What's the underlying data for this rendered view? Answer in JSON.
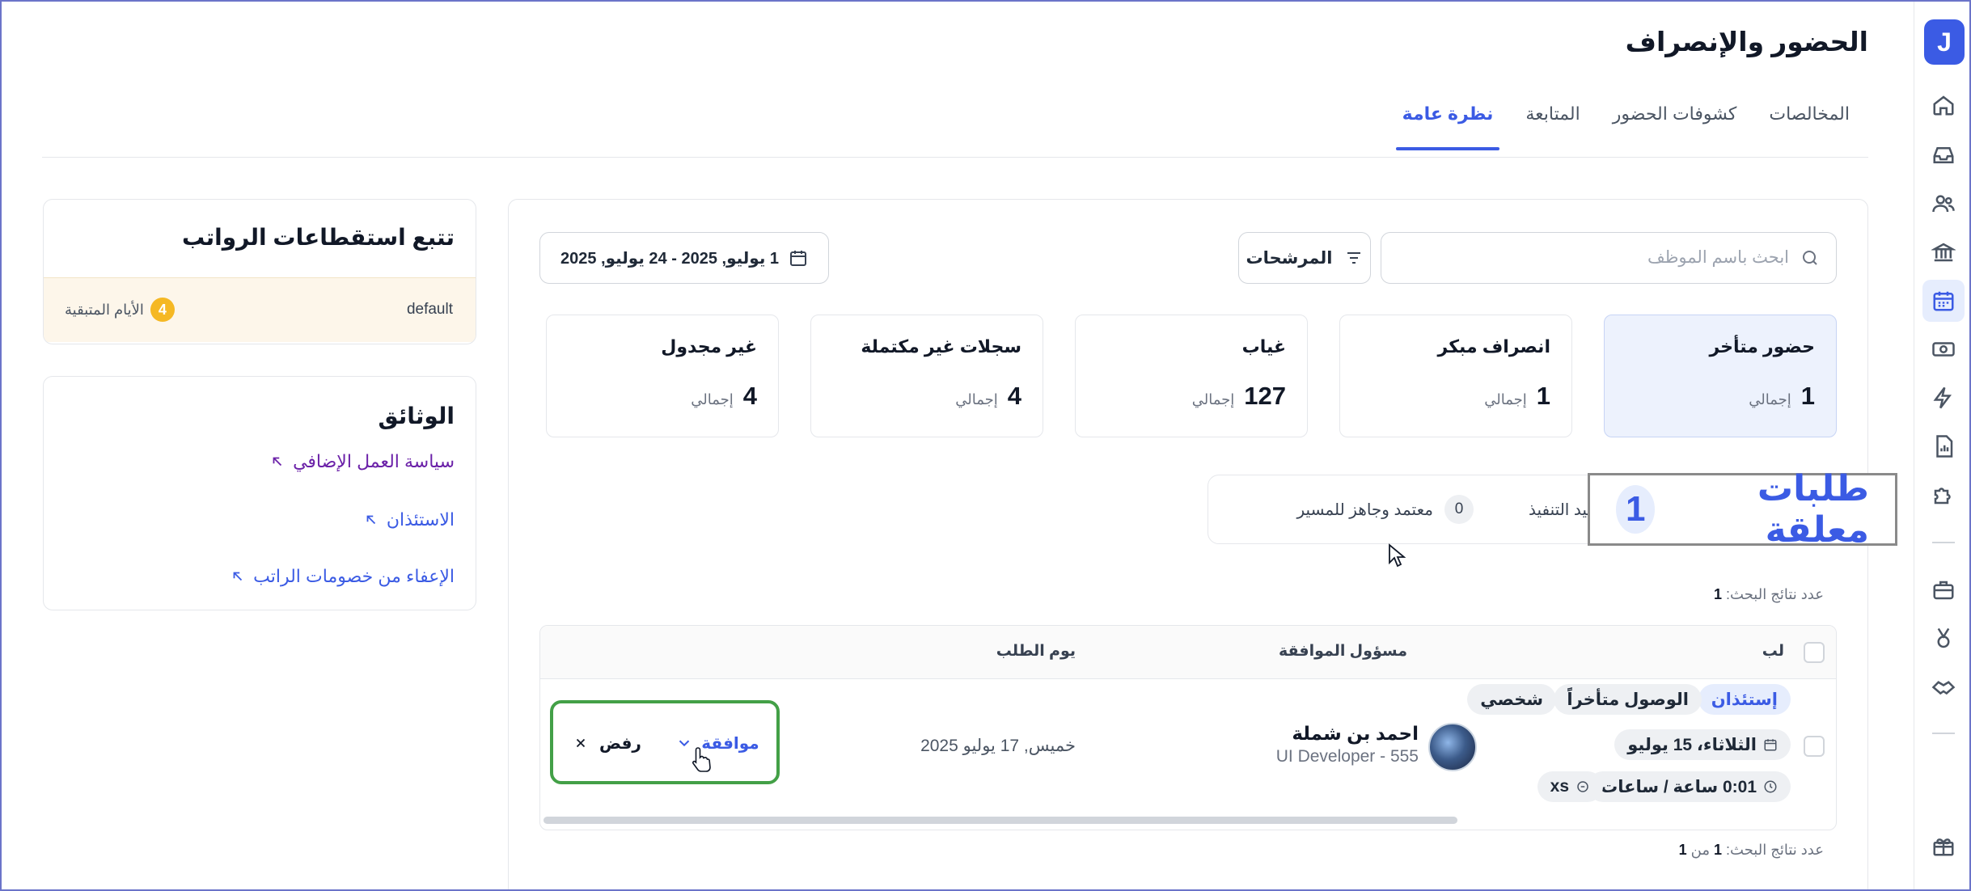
{
  "app": {
    "logo_letter": "J"
  },
  "header": {
    "title": "الحضور والإنصراف",
    "tabs": [
      {
        "label": "نظرة عامة",
        "active": true
      },
      {
        "label": "المتابعة",
        "active": false
      },
      {
        "label": "كشوفات الحضور",
        "active": false
      },
      {
        "label": "المخالصات",
        "active": false
      }
    ]
  },
  "sidebar": {
    "icons": [
      "home-icon",
      "inbox-icon",
      "users-icon",
      "bank-icon",
      "calendar-icon",
      "money-icon",
      "automation-icon",
      "report-icon",
      "puzzle-icon",
      "briefcase-icon",
      "medal-icon",
      "handshake-icon",
      "gift-icon"
    ],
    "active": "calendar-icon"
  },
  "toolbar": {
    "search_placeholder": "ابحث باسم الموظف",
    "filters_label": "المرشحات",
    "date_range": "1 يوليو, 2025 - 24 يوليو, 2025"
  },
  "stats": [
    {
      "label": "حضور متأخر",
      "value": "1",
      "unit": "إجمالي",
      "active": true
    },
    {
      "label": "انصراف مبكر",
      "value": "1",
      "unit": "إجمالي",
      "active": false
    },
    {
      "label": "غياب",
      "value": "127",
      "unit": "إجمالي",
      "active": false
    },
    {
      "label": "سجلات غير مكتملة",
      "value": "4",
      "unit": "إجمالي",
      "active": false
    },
    {
      "label": "غير مجدول",
      "value": "4",
      "unit": "إجمالي",
      "active": false
    }
  ],
  "status_filters": [
    {
      "label": "قيد التنفيذ",
      "count": "1"
    },
    {
      "label": "معتمد وجاهز للمسير",
      "count": "0"
    }
  ],
  "zoom_callout": {
    "label": "طلبات معلقة",
    "count": "1"
  },
  "results": {
    "top_label": "عدد نتائج البحث:",
    "top_count": "1",
    "bottom_label": "عدد نتائج البحث:",
    "bottom_count": "1",
    "bottom_of": "من",
    "bottom_total": "1"
  },
  "table": {
    "headers": {
      "request": "لب",
      "approver": "مسؤول الموافقة",
      "request_day": "يوم الطلب"
    },
    "rows": [
      {
        "type_tag": "إستئذان",
        "reason_tag": "الوصول متأخراً",
        "category_tag": "شخصي",
        "date": "الثلاثاء، 15 يوليو",
        "duration": "0:01 ساعة / ساعات",
        "size_tag": "xs",
        "approver_name": "احمد بن شملة",
        "approver_role": "UI Developer - 555",
        "request_day": "خميس, 17 يوليو 2025",
        "approve_label": "موافقة",
        "reject_label": "رفض"
      }
    ]
  },
  "payroll_card": {
    "title": "تتبع استقطاعات الرواتب",
    "policy": "default",
    "remaining_days": "4",
    "remaining_label": "الأيام المتبقية"
  },
  "documents_card": {
    "title": "الوثائق",
    "links": [
      {
        "label": "سياسة العمل الإضافي",
        "color": "#6b21a8"
      },
      {
        "label": "الاستئذان",
        "color": "#3b5be4"
      },
      {
        "label": "الإعفاء من خصومات الراتب",
        "color": "#3b5be4"
      }
    ]
  }
}
